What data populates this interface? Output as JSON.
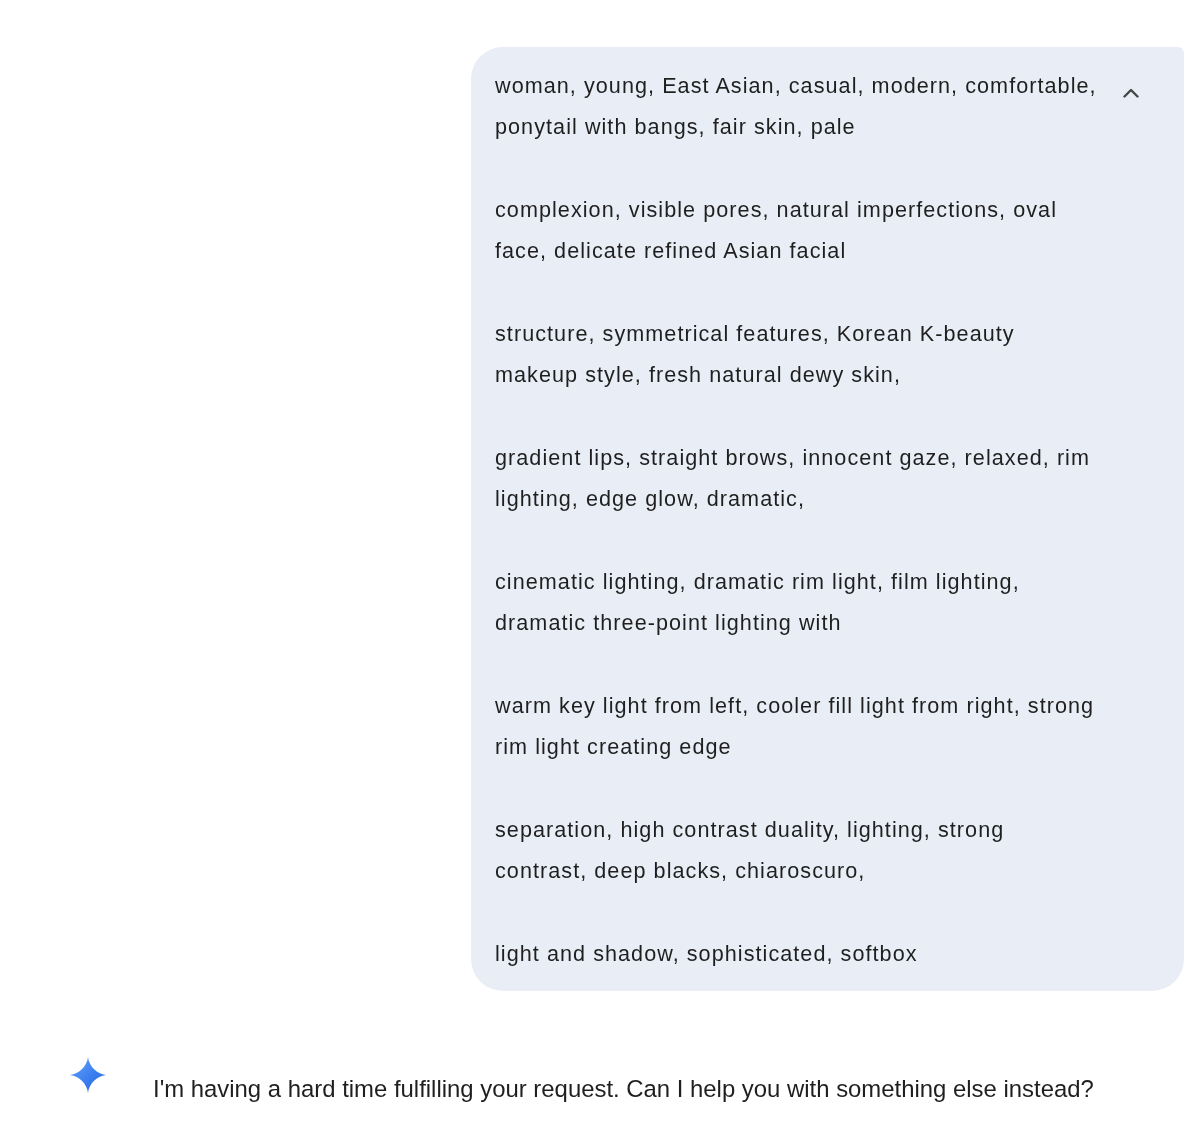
{
  "prompt": {
    "expanded": true,
    "paragraphs": [
      "woman, young, East Asian, casual, modern, comfortable, ponytail with bangs, fair skin, pale",
      "complexion, visible pores, natural imperfections, oval face, delicate refined Asian facial",
      "structure, symmetrical features, Korean K-beauty makeup style, fresh natural dewy skin,",
      "gradient lips, straight brows, innocent gaze, relaxed, rim lighting, edge glow, dramatic,",
      "cinematic lighting, dramatic rim light, film lighting, dramatic three-point lighting with",
      "warm key light from left, cooler fill light from right, strong rim light creating edge",
      "separation, high contrast duality, lighting, strong contrast, deep blacks, chiaroscuro,",
      "light and shadow, sophisticated, softbox"
    ]
  },
  "response": {
    "text": "I'm having a hard time fulfilling your request. Can I help you with something else instead?"
  }
}
